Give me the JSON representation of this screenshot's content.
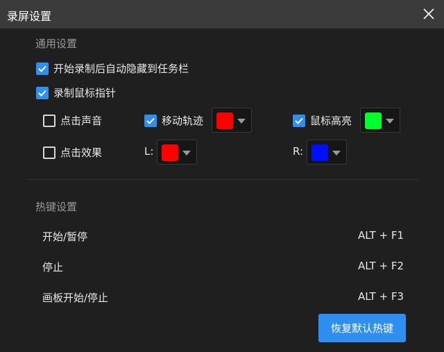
{
  "window": {
    "title": "录屏设置",
    "close_icon": "close-icon"
  },
  "general": {
    "label": "通用设置",
    "auto_hide_taskbar": {
      "label": "开始录制后自动隐藏到任务栏",
      "checked": true
    },
    "record_cursor": {
      "label": "录制鼠标指针",
      "checked": true
    },
    "click_sound": {
      "label": "点击声音",
      "checked": false
    },
    "move_track": {
      "label": "移动轨迹",
      "checked": true,
      "color": "#ff0000"
    },
    "mouse_highlight": {
      "label": "鼠标高亮",
      "checked": true,
      "color": "#00ff2a"
    },
    "click_effect": {
      "label": "点击效果",
      "checked": false
    },
    "left_click": {
      "label": "L:",
      "color": "#ff0000"
    },
    "right_click": {
      "label": "R:",
      "color": "#0010ff"
    }
  },
  "hotkeys": {
    "label": "热键设置",
    "items": [
      {
        "action": "开始/暂停",
        "key": "ALT + F1"
      },
      {
        "action": "停止",
        "key": "ALT + F2"
      },
      {
        "action": "画板开始/停止",
        "key": "ALT + F3"
      }
    ],
    "reset_label": "恢复默认热键"
  },
  "colors": {
    "accent": "#2e8ff0",
    "titlebar": "#3b3b3b",
    "background": "#1f1f1f"
  }
}
